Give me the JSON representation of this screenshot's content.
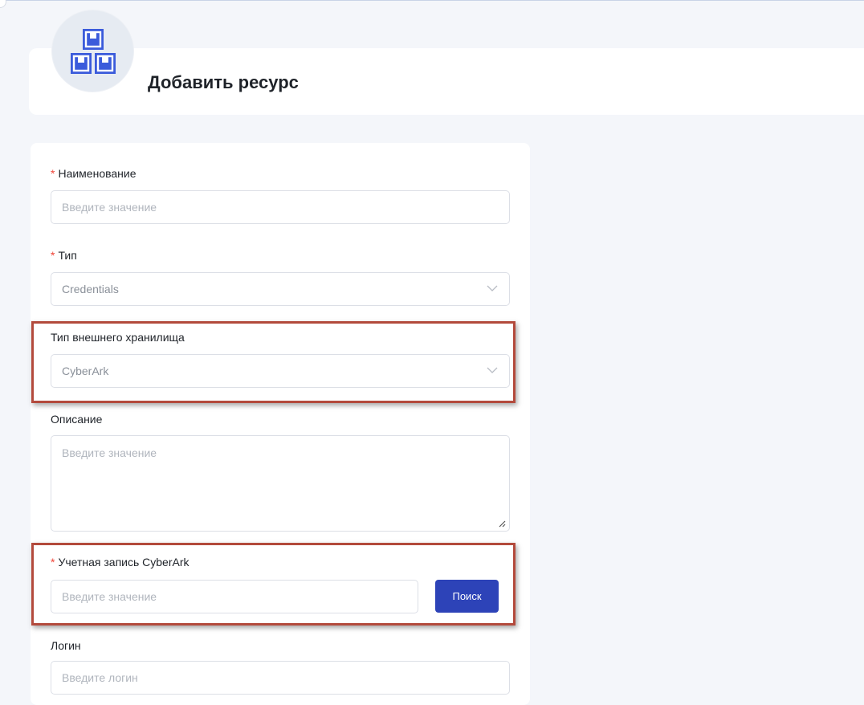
{
  "page": {
    "title": "Добавить ресурс"
  },
  "form": {
    "name": {
      "label": "Наименование",
      "required_mark": "*",
      "placeholder": "Введите значение"
    },
    "type": {
      "label": "Тип",
      "required_mark": "*",
      "value": "Credentials"
    },
    "storage_type": {
      "label": "Тип внешнего хранилища",
      "value": "CyberArk"
    },
    "description": {
      "label": "Описание",
      "placeholder": "Введите значение"
    },
    "cyberark_account": {
      "label": "Учетная запись CyberArk",
      "required_mark": "*",
      "placeholder": "Введите значение",
      "search_button": "Поиск"
    },
    "login": {
      "label": "Логин",
      "placeholder": "Введите логин"
    }
  },
  "colors": {
    "accent": "#2d43b8",
    "required": "#f04438",
    "highlight": "#b34a3c",
    "icon": "#3b5bdb"
  },
  "icons": {
    "avatar": "warehouse-boxes-icon",
    "select": "chevron-down-icon",
    "resize": "resize-handle-icon"
  }
}
